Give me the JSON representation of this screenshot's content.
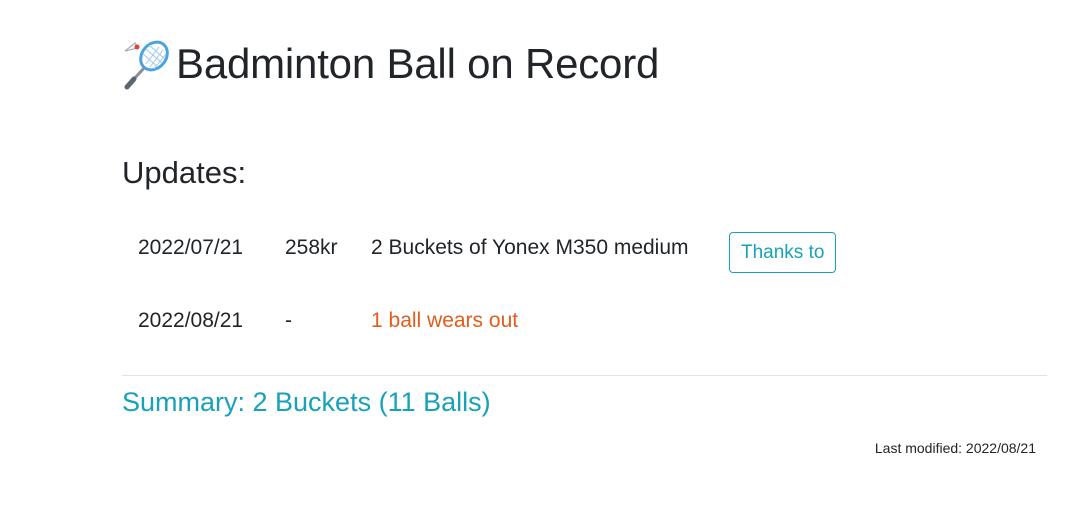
{
  "header": {
    "icon": "badminton-racket-shuttlecock-icon",
    "title": "Badminton Ball on Record"
  },
  "updates": {
    "heading": "Updates:",
    "rows": [
      {
        "date": "2022/07/21",
        "price": "258kr",
        "description": "2 Buckets of Yonex M350 medium",
        "action_label": "Thanks to"
      },
      {
        "date": "2022/08/21",
        "price": "-",
        "description": "1 ball wears out"
      }
    ]
  },
  "summary": {
    "text": "Summary: 2 Buckets (11 Balls)"
  },
  "footer": {
    "last_modified": "Last modified: 2022/08/21"
  },
  "colors": {
    "accent": "#17a2b8",
    "warning": "#e05d1c",
    "text": "#212529"
  }
}
